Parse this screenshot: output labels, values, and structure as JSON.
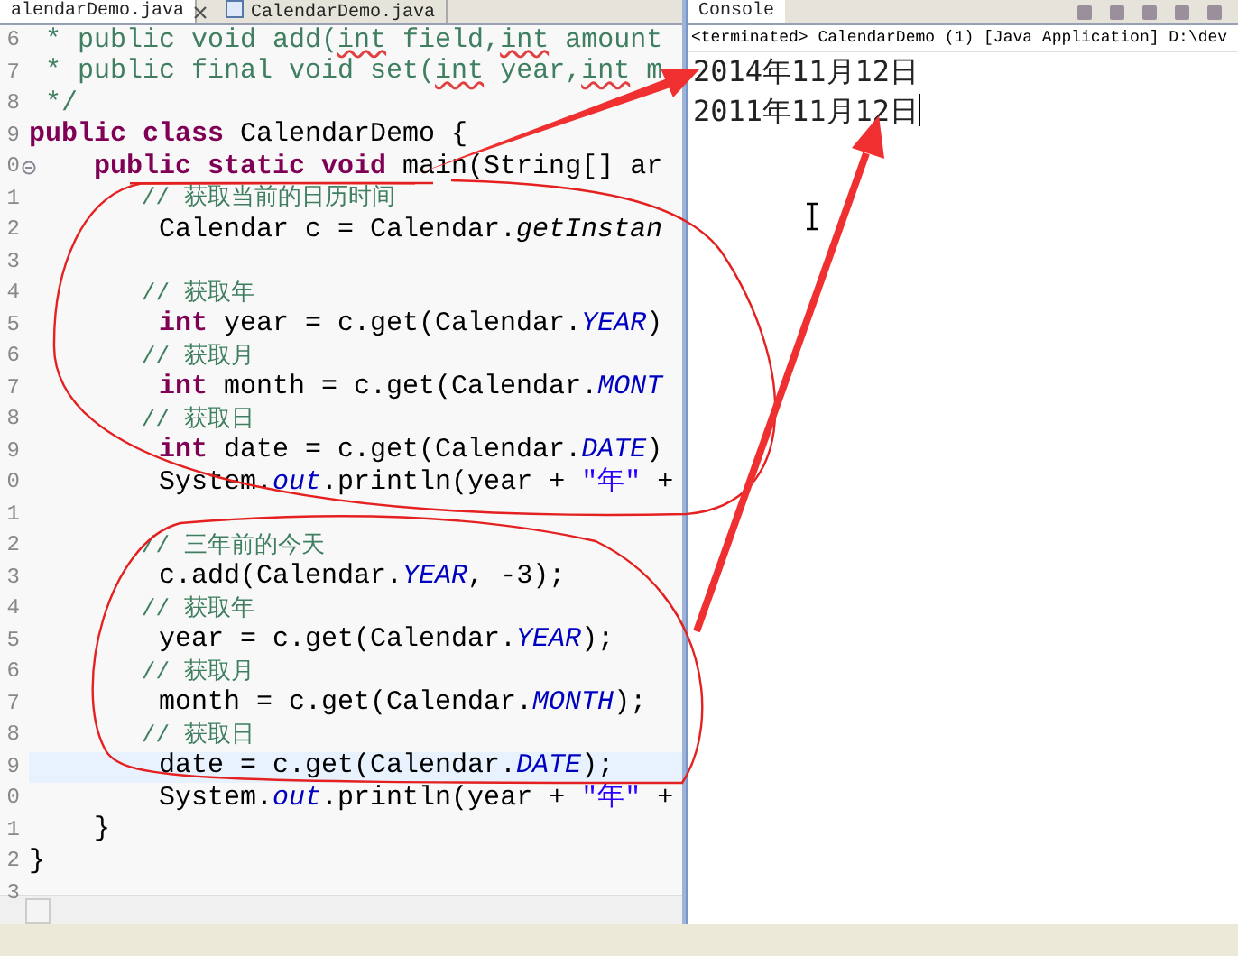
{
  "editor": {
    "tabs": [
      {
        "label": "alendarDemo.java",
        "selected": true,
        "closable": true
      },
      {
        "label": "CalendarDemo.java",
        "selected": false,
        "closable": false
      }
    ],
    "lines": [
      {
        "number": "6",
        "current": false,
        "tokens": [
          {
            "kind": "doc",
            "text": " * public void add("
          },
          {
            "kind": "flagged",
            "text": "int"
          },
          {
            "kind": "doc",
            "text": " field,"
          },
          {
            "kind": "flagged",
            "text": "int"
          },
          {
            "kind": "doc",
            "text": " amount"
          }
        ]
      },
      {
        "number": "7",
        "current": false,
        "tokens": [
          {
            "kind": "doc",
            "text": " * public final void set("
          },
          {
            "kind": "flagged",
            "text": "int"
          },
          {
            "kind": "doc",
            "text": " year,"
          },
          {
            "kind": "flagged",
            "text": "int"
          },
          {
            "kind": "doc",
            "text": " m"
          }
        ]
      },
      {
        "number": "8",
        "current": false,
        "tokens": [
          {
            "kind": "doc",
            "text": " */"
          }
        ]
      },
      {
        "number": "9",
        "current": false,
        "tokens": [
          {
            "kind": "keyword",
            "text": "public"
          },
          {
            "kind": "keyword",
            "text": " class"
          },
          {
            "kind": "text",
            "text": " CalendarDemo {"
          }
        ]
      },
      {
        "number": "0",
        "current": false,
        "fold": true,
        "tokens": [
          {
            "kind": "keyword",
            "text": "    public"
          },
          {
            "kind": "keyword",
            "text": " static"
          },
          {
            "kind": "keyword",
            "text": " void"
          },
          {
            "kind": "text",
            "text": " main(String[] ar"
          }
        ]
      },
      {
        "number": "1",
        "current": false,
        "tokens": [
          {
            "kind": "comment",
            "text": "        // 获取当前的日历时间"
          }
        ]
      },
      {
        "number": "2",
        "current": false,
        "tokens": [
          {
            "kind": "text",
            "text": "        Calendar c = Calendar."
          },
          {
            "kind": "italic",
            "text": "getInstan"
          }
        ]
      },
      {
        "number": "3",
        "current": false
      },
      {
        "number": "4",
        "current": false,
        "tokens": [
          {
            "kind": "comment",
            "text": "        // 获取年"
          }
        ]
      },
      {
        "number": "5",
        "current": false,
        "tokens": [
          {
            "kind": "keyword",
            "text": "        int"
          },
          {
            "kind": "text",
            "text": " year = c.get(Calendar."
          },
          {
            "kind": "field",
            "text": "YEAR"
          },
          {
            "kind": "text",
            "text": ")"
          }
        ]
      },
      {
        "number": "6",
        "current": false,
        "tokens": [
          {
            "kind": "comment",
            "text": "        // 获取月"
          }
        ]
      },
      {
        "number": "7",
        "current": false,
        "tokens": [
          {
            "kind": "keyword",
            "text": "        int"
          },
          {
            "kind": "text",
            "text": " month = c.get(Calendar."
          },
          {
            "kind": "field",
            "text": "MONT"
          }
        ]
      },
      {
        "number": "8",
        "current": false,
        "tokens": [
          {
            "kind": "comment",
            "text": "        // 获取日"
          }
        ]
      },
      {
        "number": "9",
        "current": false,
        "tokens": [
          {
            "kind": "keyword",
            "text": "        int"
          },
          {
            "kind": "text",
            "text": " date = c.get(Calendar."
          },
          {
            "kind": "field",
            "text": "DATE"
          },
          {
            "kind": "text",
            "text": ")"
          }
        ]
      },
      {
        "number": "0",
        "current": false,
        "tokens": [
          {
            "kind": "text",
            "text": "        System."
          },
          {
            "kind": "field",
            "text": "out"
          },
          {
            "kind": "text",
            "text": ".println(year + "
          },
          {
            "kind": "string",
            "text": "\"年\""
          },
          {
            "kind": "text",
            "text": " +"
          }
        ]
      },
      {
        "number": "1",
        "current": false
      },
      {
        "number": "2",
        "current": false,
        "tokens": [
          {
            "kind": "comment",
            "text": "        // 三年前的今天"
          }
        ]
      },
      {
        "number": "3",
        "current": false,
        "tokens": [
          {
            "kind": "text",
            "text": "        c.add(Calendar."
          },
          {
            "kind": "field",
            "text": "YEAR"
          },
          {
            "kind": "text",
            "text": ", -3);"
          }
        ]
      },
      {
        "number": "4",
        "current": false,
        "tokens": [
          {
            "kind": "comment",
            "text": "        // 获取年"
          }
        ]
      },
      {
        "number": "5",
        "current": false,
        "tokens": [
          {
            "kind": "text",
            "text": "        year = c.get(Calendar."
          },
          {
            "kind": "field",
            "text": "YEAR"
          },
          {
            "kind": "text",
            "text": ");"
          }
        ]
      },
      {
        "number": "6",
        "current": false,
        "tokens": [
          {
            "kind": "comment",
            "text": "        // 获取月"
          }
        ]
      },
      {
        "number": "7",
        "current": false,
        "tokens": [
          {
            "kind": "text",
            "text": "        month = c.get(Calendar."
          },
          {
            "kind": "field",
            "text": "MONTH"
          },
          {
            "kind": "text",
            "text": ");"
          }
        ]
      },
      {
        "number": "8",
        "current": false,
        "tokens": [
          {
            "kind": "comment",
            "text": "        // 获取日"
          }
        ]
      },
      {
        "number": "9",
        "current": true,
        "tokens": [
          {
            "kind": "text",
            "text": "        date = c.get(Calendar."
          },
          {
            "kind": "field",
            "text": "DATE"
          },
          {
            "kind": "text",
            "text": ");"
          }
        ]
      },
      {
        "number": "0",
        "current": false,
        "tokens": [
          {
            "kind": "text",
            "text": "        System."
          },
          {
            "kind": "field",
            "text": "out"
          },
          {
            "kind": "text",
            "text": ".println(year + "
          },
          {
            "kind": "string",
            "text": "\"年\""
          },
          {
            "kind": "text",
            "text": " +"
          }
        ]
      },
      {
        "number": "1",
        "current": false,
        "tokens": [
          {
            "kind": "text",
            "text": "    }"
          }
        ]
      },
      {
        "number": "2",
        "current": false,
        "tokens": [
          {
            "kind": "text",
            "text": "}"
          }
        ]
      },
      {
        "number": "3",
        "current": false
      }
    ]
  },
  "console": {
    "tab": {
      "label": "Console",
      "selected": true
    },
    "header": "<terminated> CalendarDemo (1) [Java Application] D:\\dev",
    "output": [
      "2014年11月12日",
      "2011年11月12日"
    ]
  }
}
